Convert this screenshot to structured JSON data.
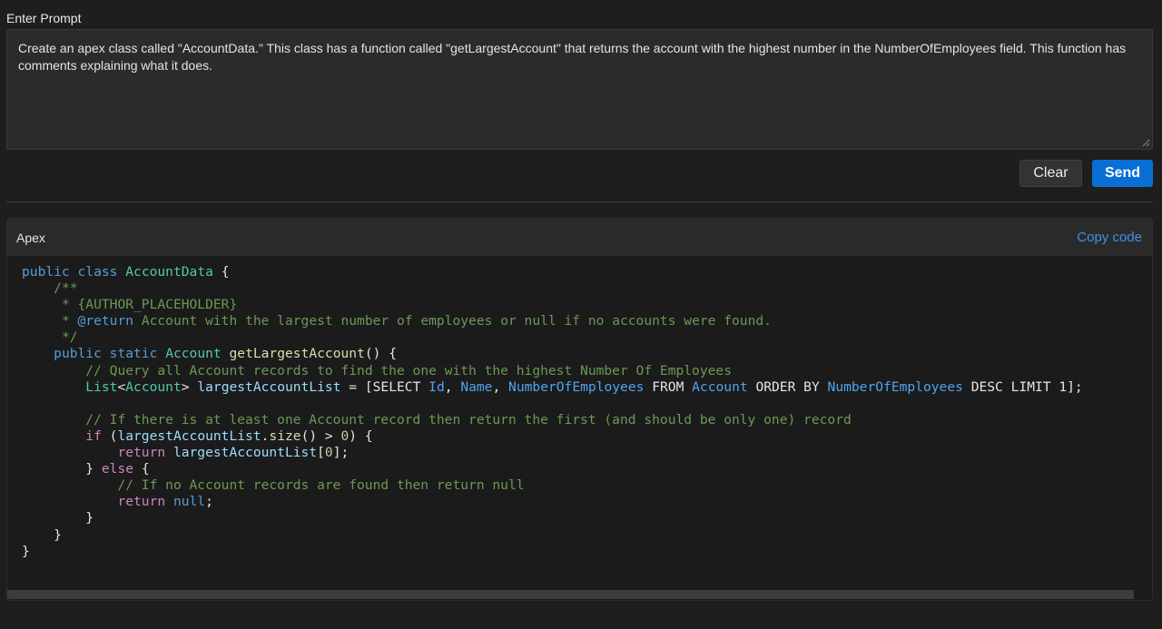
{
  "prompt": {
    "label": "Enter Prompt",
    "value": "Create an apex class called \"AccountData.\" This class has a function called \"getLargestAccount\" that returns the account with the highest number in the NumberOfEmployees field. This function has comments explaining what it does."
  },
  "buttons": {
    "clear": "Clear",
    "send": "Send"
  },
  "code_panel": {
    "language": "Apex",
    "copy_label": "Copy code",
    "lines": [
      [
        [
          "kw",
          "public"
        ],
        [
          "",
          ""
        ],
        [
          "",
          " "
        ],
        [
          "kw",
          "class"
        ],
        [
          "",
          " "
        ],
        [
          "ty",
          "AccountData"
        ],
        [
          "",
          " {"
        ]
      ],
      [
        [
          "",
          "    "
        ],
        [
          "cm",
          "/**"
        ]
      ],
      [
        [
          "",
          "     "
        ],
        [
          "cm",
          "* {AUTHOR_PLACEHOLDER}"
        ]
      ],
      [
        [
          "",
          "     "
        ],
        [
          "cm",
          "* "
        ],
        [
          "tag",
          "@return"
        ],
        [
          "cm",
          " Account with the largest number of employees or null if no accounts were found."
        ]
      ],
      [
        [
          "",
          "     "
        ],
        [
          "cm",
          "*/"
        ]
      ],
      [
        [
          "",
          "    "
        ],
        [
          "kw",
          "public"
        ],
        [
          "",
          " "
        ],
        [
          "kw",
          "static"
        ],
        [
          "",
          " "
        ],
        [
          "ty",
          "Account"
        ],
        [
          "",
          " "
        ],
        [
          "fn",
          "getLargestAccount"
        ],
        [
          "",
          "() {"
        ]
      ],
      [
        [
          "",
          "        "
        ],
        [
          "cm",
          "// Query all Account records to find the one with the highest Number Of Employees"
        ]
      ],
      [
        [
          "",
          "        "
        ],
        [
          "ty",
          "List"
        ],
        [
          "",
          "<"
        ],
        [
          "ty",
          "Account"
        ],
        [
          "",
          "> "
        ],
        [
          "var",
          "largestAccountList"
        ],
        [
          "",
          " = [SELECT "
        ],
        [
          "fld",
          "Id"
        ],
        [
          "",
          ", "
        ],
        [
          "fld",
          "Name"
        ],
        [
          "",
          ", "
        ],
        [
          "fld",
          "NumberOfEmployees"
        ],
        [
          "",
          " FROM "
        ],
        [
          "fld",
          "Account"
        ],
        [
          "",
          " ORDER BY "
        ],
        [
          "fld",
          "NumberOfEmployees"
        ],
        [
          "",
          " DESC LIMIT 1];"
        ]
      ],
      [
        [
          "",
          ""
        ]
      ],
      [
        [
          "",
          "        "
        ],
        [
          "cm",
          "// If there is at least one Account record then return the first (and should be only one) record"
        ]
      ],
      [
        [
          "",
          "        "
        ],
        [
          "ctl",
          "if"
        ],
        [
          "",
          " ("
        ],
        [
          "var",
          "largestAccountList"
        ],
        [
          "",
          "."
        ],
        [
          "fn",
          "size"
        ],
        [
          "",
          "() > "
        ],
        [
          "num",
          "0"
        ],
        [
          "",
          ") {"
        ]
      ],
      [
        [
          "",
          "            "
        ],
        [
          "ctl",
          "return"
        ],
        [
          "",
          " "
        ],
        [
          "var",
          "largestAccountList"
        ],
        [
          "",
          "["
        ],
        [
          "num",
          "0"
        ],
        [
          "",
          "];"
        ]
      ],
      [
        [
          "",
          "        } "
        ],
        [
          "ctl",
          "else"
        ],
        [
          "",
          " {"
        ]
      ],
      [
        [
          "",
          "            "
        ],
        [
          "cm",
          "// If no Account records are found then return null"
        ]
      ],
      [
        [
          "",
          "            "
        ],
        [
          "ctl",
          "return"
        ],
        [
          "",
          " "
        ],
        [
          "kw",
          "null"
        ],
        [
          "",
          ";"
        ]
      ],
      [
        [
          "",
          "        }"
        ]
      ],
      [
        [
          "",
          "    }"
        ]
      ],
      [
        [
          "",
          "}"
        ]
      ]
    ]
  },
  "colors": {
    "background": "#1e1e1e",
    "send_button": "#0a6fd4",
    "copy_link": "#3b93ec"
  }
}
